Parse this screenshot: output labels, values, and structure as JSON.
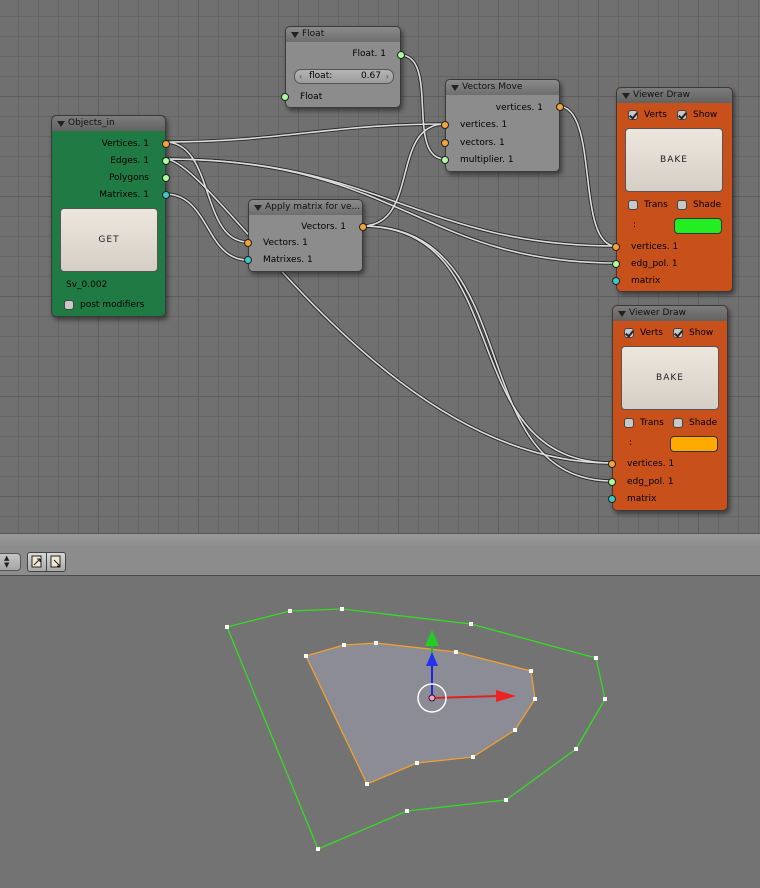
{
  "nodes": {
    "float_node": {
      "title": "Float",
      "out": "Float. 1",
      "field_label": "float:",
      "field_value": "0.67",
      "in": "Float"
    },
    "objects_in": {
      "title": "Objects_in",
      "outs": [
        "Vertices. 1",
        "Edges. 1",
        "Polygons",
        "Matrixes. 1"
      ],
      "button": "GET",
      "name": "Sv_0.002",
      "checkbox": "post modifiers"
    },
    "apply_matrix": {
      "title": "Apply matrix for ve...",
      "out": "Vectors. 1",
      "ins": [
        "Vectors. 1",
        "Matrixes. 1"
      ]
    },
    "vectors_move": {
      "title": "Vectors Move",
      "out": "vertices. 1",
      "ins": [
        "vertices. 1",
        "vectors. 1",
        "multiplier. 1"
      ]
    },
    "viewer_draw_1": {
      "title": "Viewer Draw",
      "verts": "Verts",
      "show": "Show",
      "button": "BAKE",
      "trans": "Trans",
      "shade": "Shade",
      "colon": ":",
      "color": "#22ee22",
      "ins": [
        "vertices. 1",
        "edg_pol. 1",
        "matrix"
      ]
    },
    "viewer_draw_2": {
      "title": "Viewer Draw",
      "verts": "Verts",
      "show": "Show",
      "button": "BAKE",
      "trans": "Trans",
      "shade": "Shade",
      "colon": ":",
      "color": "#ffaa00",
      "ins": [
        "vertices. 1",
        "edg_pol. 1",
        "matrix"
      ]
    }
  },
  "colors": {
    "node_green": "#1f7a44",
    "node_orange": "#c8501a",
    "socket_vertices": "#f5a33a",
    "socket_edges": "#a8ff9c",
    "socket_matrix": "#3dc8c8"
  },
  "toolbar": {
    "spinner_icon": "updown-spinner-icon",
    "copy_icon": "copy-nodes-icon",
    "paste_icon": "paste-nodes-icon"
  }
}
